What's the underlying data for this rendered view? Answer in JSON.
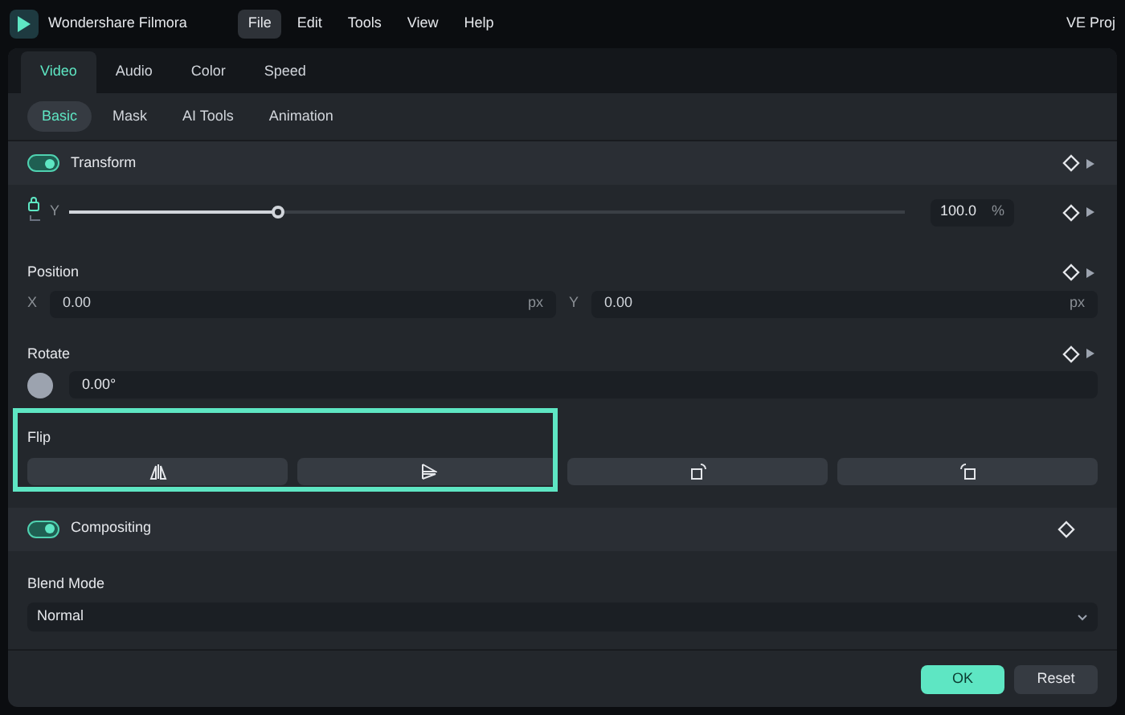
{
  "app": {
    "name": "Wondershare Filmora",
    "project": "VE Proj"
  },
  "menu": [
    {
      "label": "File",
      "selected": true
    },
    {
      "label": "Edit",
      "selected": false
    },
    {
      "label": "Tools",
      "selected": false
    },
    {
      "label": "View",
      "selected": false
    },
    {
      "label": "Help",
      "selected": false
    }
  ],
  "tabs": [
    {
      "label": "Video",
      "selected": true
    },
    {
      "label": "Audio",
      "selected": false
    },
    {
      "label": "Color",
      "selected": false
    },
    {
      "label": "Speed",
      "selected": false
    }
  ],
  "subtabs": [
    {
      "label": "Basic",
      "selected": true
    },
    {
      "label": "Mask",
      "selected": false
    },
    {
      "label": "AI Tools",
      "selected": false
    },
    {
      "label": "Animation",
      "selected": false
    }
  ],
  "transform": {
    "title": "Transform",
    "on": true,
    "scale_y": {
      "label": "Y",
      "level": 0.25,
      "value": "100.0",
      "unit": "%"
    }
  },
  "position": {
    "title": "Position",
    "x": {
      "label": "X",
      "value": "0.00",
      "unit": "px"
    },
    "y": {
      "label": "Y",
      "value": "0.00",
      "unit": "px"
    }
  },
  "rotate": {
    "title": "Rotate",
    "value": "0.00°"
  },
  "flip": {
    "title": "Flip",
    "highlighted": true
  },
  "compositing": {
    "title": "Compositing",
    "on": true
  },
  "blend_mode": {
    "title": "Blend Mode",
    "value": "Normal"
  },
  "buttons": [
    {
      "label": "OK",
      "kind": "primary"
    },
    {
      "label": "Reset",
      "kind": "secondary"
    }
  ]
}
